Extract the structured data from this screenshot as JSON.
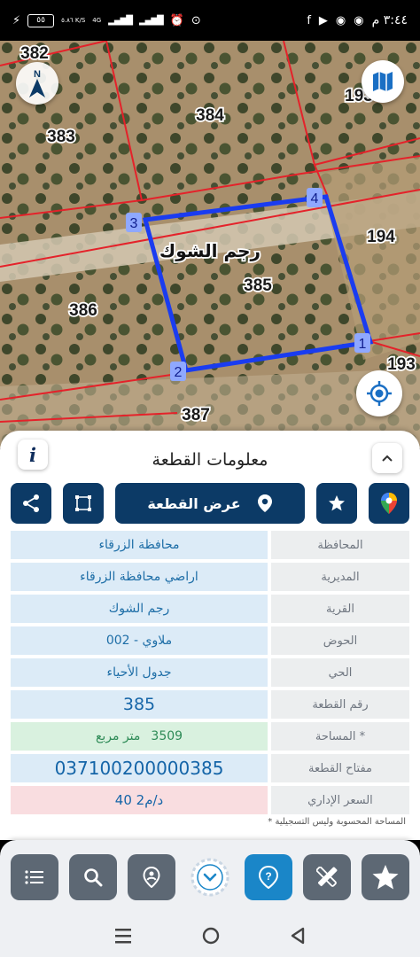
{
  "status_bar": {
    "time": "٣:٤٤ م",
    "battery": "٥٥",
    "network": "4G",
    "speed": "٥.٨٦ K/S"
  },
  "map": {
    "parcels": {
      "p382": "382",
      "p384": "384",
      "p383": "383",
      "p193top": "193",
      "p194": "194",
      "p385": "385",
      "p386": "386",
      "p193": "193",
      "p387": "387"
    },
    "village_label": "رجم الشوك",
    "vertices": {
      "v1": "1",
      "v2": "2",
      "v3": "3",
      "v4": "4"
    },
    "compass_letter": "N"
  },
  "panel": {
    "title": "معلومات القطعة",
    "show_parcel_label": "عرض القطعة",
    "rows": [
      {
        "key": "المحافظة",
        "value": "محافظة الزرقاء"
      },
      {
        "key": "المديرية",
        "value": "اراضي محافظة الزرقاء"
      },
      {
        "key": "القرية",
        "value": "رجم الشوك"
      },
      {
        "key": "الحوض",
        "value": "ملاوي - 002"
      },
      {
        "key": "الحي",
        "value": "جدول الأحياء"
      },
      {
        "key": "رقم القطعة",
        "value": "385"
      },
      {
        "key": "المساحة *",
        "value": "3509",
        "unit": "متر مربع"
      },
      {
        "key": "مفتاح القطعة",
        "value": "037100200000385"
      },
      {
        "key": "السعر الإداري",
        "value": "40 د/م2"
      }
    ],
    "footnote": "* المساحة المحسوبة وليس التسجيلية"
  },
  "colors": {
    "primary": "#0c3a66",
    "parcel_outline": "#1a3cf0",
    "parcel_lines": "#e4222a",
    "help_button": "#1a86c8",
    "toolbar_button": "#5d6874"
  }
}
